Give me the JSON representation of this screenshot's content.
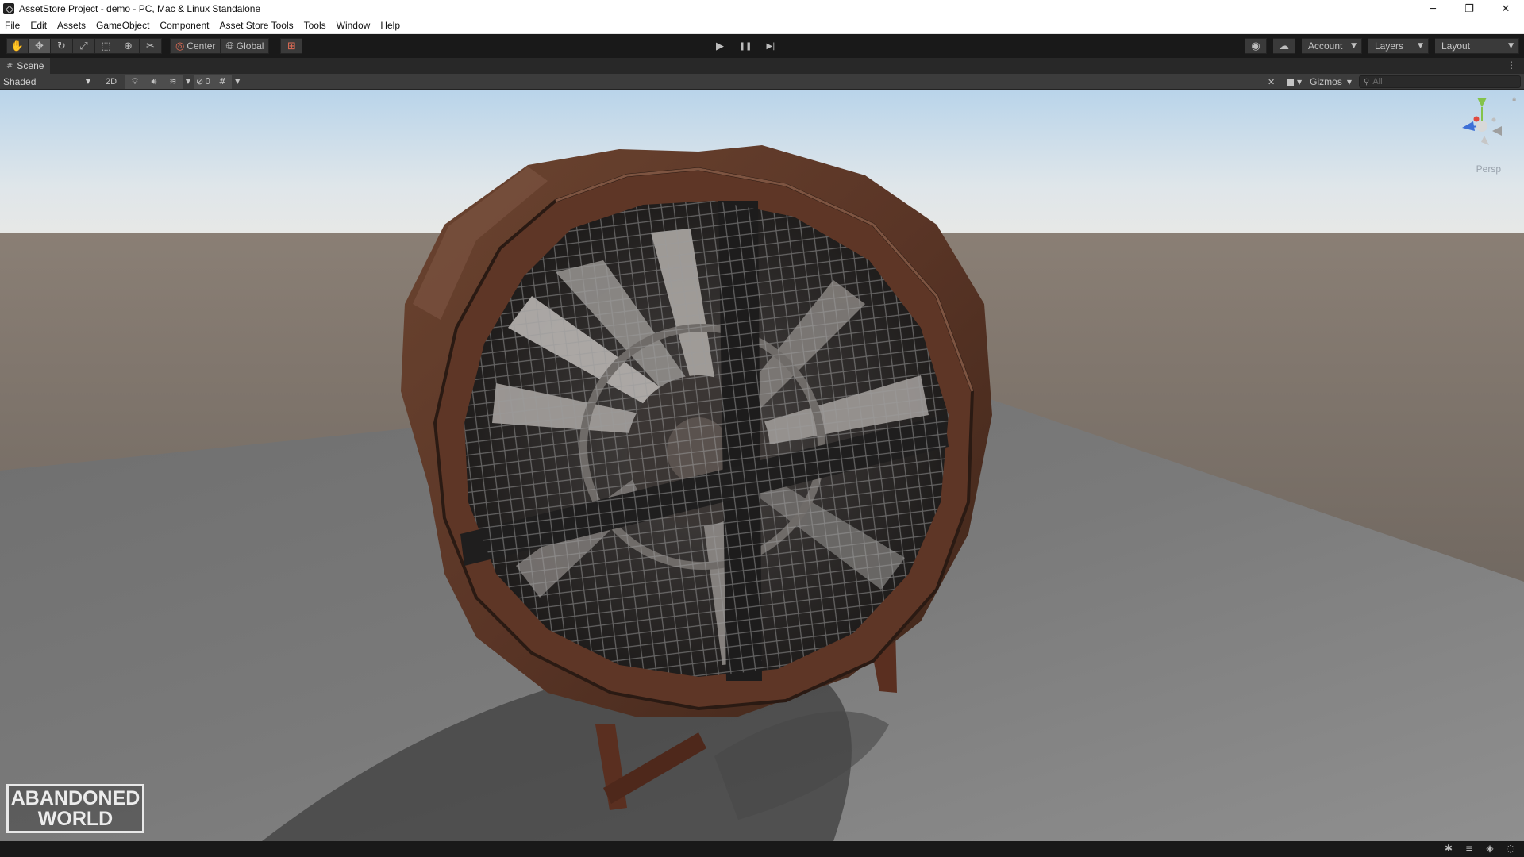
{
  "window": {
    "title": "AssetStore Project - demo - PC, Mac & Linux Standalone",
    "controls": [
      "─",
      "❐",
      "✕"
    ]
  },
  "menu": [
    "File",
    "Edit",
    "Assets",
    "GameObject",
    "Component",
    "Asset Store Tools",
    "Tools",
    "Window",
    "Help"
  ],
  "toolbar": {
    "tools": [
      {
        "name": "hand-tool",
        "icon": "✋"
      },
      {
        "name": "move-tool",
        "icon": "✥"
      },
      {
        "name": "rotate-tool",
        "icon": "↻"
      },
      {
        "name": "scale-tool",
        "icon": "⤢"
      },
      {
        "name": "rect-tool",
        "icon": "⬚"
      },
      {
        "name": "transform-tool",
        "icon": "⊕"
      },
      {
        "name": "custom-tool",
        "icon": "✂"
      }
    ],
    "pivot_mode": "Center",
    "pivot_rotation": "Global",
    "snap_icon": "⊞",
    "play": "▶",
    "pause": "❚❚",
    "step": "▶|",
    "account": "Account",
    "layers": "Layers",
    "layout": "Layout"
  },
  "scene": {
    "tab_label": "Scene",
    "shading": "Shaded",
    "mode_2d": "2D",
    "hidden_count": "0",
    "gizmos": "Gizmos",
    "search_placeholder": "All",
    "view_label": "Persp"
  },
  "logo": {
    "line1": "ABANDONED",
    "line2": "WORLD"
  }
}
